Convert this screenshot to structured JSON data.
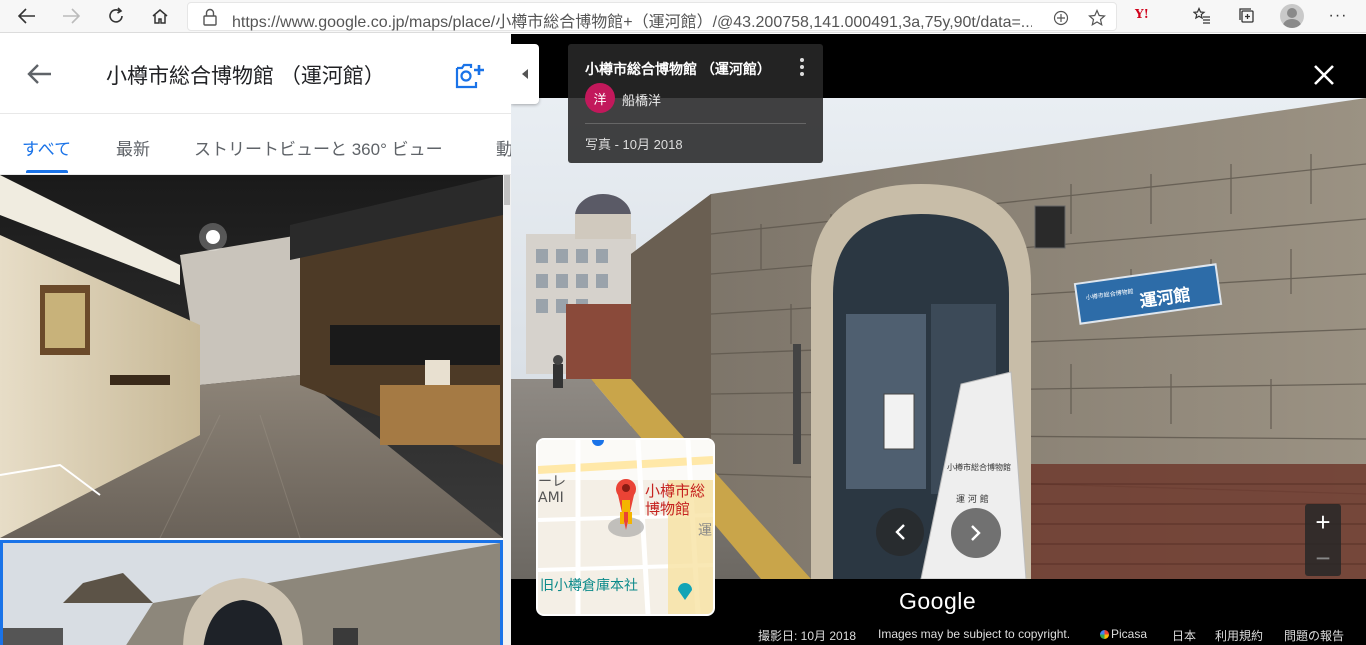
{
  "browser": {
    "url": "https://www.google.co.jp/maps/place/小樽市総合博物館+（運河館）/@43.200758,141.000491,3a,75y,90t/data=..."
  },
  "panel": {
    "title": "小樽市総合博物館 （運河館）",
    "tabs": [
      {
        "label": "すべて"
      },
      {
        "label": "最新"
      },
      {
        "label": "ストリートビューと 360° ビュー"
      },
      {
        "label": "動"
      }
    ]
  },
  "viewer": {
    "info": {
      "title": "小樽市総合博物館 （運河館）",
      "author_initial": "洋",
      "author_name": "船橋洋",
      "date": "写真 - 10月 2018"
    },
    "zoom_in": "+",
    "zoom_out": "−",
    "mini_map": {
      "label_line1": "小樽市総",
      "label_line2": "博物館",
      "street_label": "旧小樽倉庫本社",
      "edge_label1": "ーレ",
      "edge_label2": "AMI",
      "edge_char": "運"
    },
    "logo": "Google",
    "footer": {
      "date": "撮影日: 10月 2018",
      "copyright": "Images may be subject to copyright.",
      "picasa": "Picasa",
      "country": "日本",
      "terms": "利用規約",
      "report": "問題の報告"
    },
    "sign_text": "運河館",
    "sign_sub": "小樽市総合博物館",
    "monument_title": "小樽市総合博物館",
    "monument_sub": "運 河 館",
    "colors": {
      "accent": "#1a73e8",
      "author_badge": "#c2185b",
      "map_pin": "#ea4335"
    }
  }
}
